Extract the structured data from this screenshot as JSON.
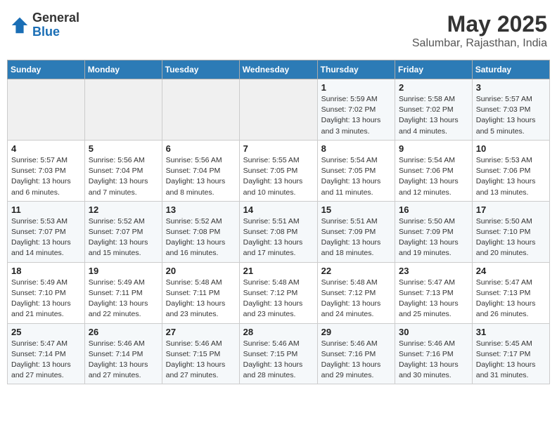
{
  "header": {
    "logo_general": "General",
    "logo_blue": "Blue",
    "month": "May 2025",
    "location": "Salumbar, Rajasthan, India"
  },
  "weekdays": [
    "Sunday",
    "Monday",
    "Tuesday",
    "Wednesday",
    "Thursday",
    "Friday",
    "Saturday"
  ],
  "weeks": [
    [
      {
        "day": "",
        "info": ""
      },
      {
        "day": "",
        "info": ""
      },
      {
        "day": "",
        "info": ""
      },
      {
        "day": "",
        "info": ""
      },
      {
        "day": "1",
        "info": "Sunrise: 5:59 AM\nSunset: 7:02 PM\nDaylight: 13 hours\nand 3 minutes."
      },
      {
        "day": "2",
        "info": "Sunrise: 5:58 AM\nSunset: 7:02 PM\nDaylight: 13 hours\nand 4 minutes."
      },
      {
        "day": "3",
        "info": "Sunrise: 5:57 AM\nSunset: 7:03 PM\nDaylight: 13 hours\nand 5 minutes."
      }
    ],
    [
      {
        "day": "4",
        "info": "Sunrise: 5:57 AM\nSunset: 7:03 PM\nDaylight: 13 hours\nand 6 minutes."
      },
      {
        "day": "5",
        "info": "Sunrise: 5:56 AM\nSunset: 7:04 PM\nDaylight: 13 hours\nand 7 minutes."
      },
      {
        "day": "6",
        "info": "Sunrise: 5:56 AM\nSunset: 7:04 PM\nDaylight: 13 hours\nand 8 minutes."
      },
      {
        "day": "7",
        "info": "Sunrise: 5:55 AM\nSunset: 7:05 PM\nDaylight: 13 hours\nand 10 minutes."
      },
      {
        "day": "8",
        "info": "Sunrise: 5:54 AM\nSunset: 7:05 PM\nDaylight: 13 hours\nand 11 minutes."
      },
      {
        "day": "9",
        "info": "Sunrise: 5:54 AM\nSunset: 7:06 PM\nDaylight: 13 hours\nand 12 minutes."
      },
      {
        "day": "10",
        "info": "Sunrise: 5:53 AM\nSunset: 7:06 PM\nDaylight: 13 hours\nand 13 minutes."
      }
    ],
    [
      {
        "day": "11",
        "info": "Sunrise: 5:53 AM\nSunset: 7:07 PM\nDaylight: 13 hours\nand 14 minutes."
      },
      {
        "day": "12",
        "info": "Sunrise: 5:52 AM\nSunset: 7:07 PM\nDaylight: 13 hours\nand 15 minutes."
      },
      {
        "day": "13",
        "info": "Sunrise: 5:52 AM\nSunset: 7:08 PM\nDaylight: 13 hours\nand 16 minutes."
      },
      {
        "day": "14",
        "info": "Sunrise: 5:51 AM\nSunset: 7:08 PM\nDaylight: 13 hours\nand 17 minutes."
      },
      {
        "day": "15",
        "info": "Sunrise: 5:51 AM\nSunset: 7:09 PM\nDaylight: 13 hours\nand 18 minutes."
      },
      {
        "day": "16",
        "info": "Sunrise: 5:50 AM\nSunset: 7:09 PM\nDaylight: 13 hours\nand 19 minutes."
      },
      {
        "day": "17",
        "info": "Sunrise: 5:50 AM\nSunset: 7:10 PM\nDaylight: 13 hours\nand 20 minutes."
      }
    ],
    [
      {
        "day": "18",
        "info": "Sunrise: 5:49 AM\nSunset: 7:10 PM\nDaylight: 13 hours\nand 21 minutes."
      },
      {
        "day": "19",
        "info": "Sunrise: 5:49 AM\nSunset: 7:11 PM\nDaylight: 13 hours\nand 22 minutes."
      },
      {
        "day": "20",
        "info": "Sunrise: 5:48 AM\nSunset: 7:11 PM\nDaylight: 13 hours\nand 23 minutes."
      },
      {
        "day": "21",
        "info": "Sunrise: 5:48 AM\nSunset: 7:12 PM\nDaylight: 13 hours\nand 23 minutes."
      },
      {
        "day": "22",
        "info": "Sunrise: 5:48 AM\nSunset: 7:12 PM\nDaylight: 13 hours\nand 24 minutes."
      },
      {
        "day": "23",
        "info": "Sunrise: 5:47 AM\nSunset: 7:13 PM\nDaylight: 13 hours\nand 25 minutes."
      },
      {
        "day": "24",
        "info": "Sunrise: 5:47 AM\nSunset: 7:13 PM\nDaylight: 13 hours\nand 26 minutes."
      }
    ],
    [
      {
        "day": "25",
        "info": "Sunrise: 5:47 AM\nSunset: 7:14 PM\nDaylight: 13 hours\nand 27 minutes."
      },
      {
        "day": "26",
        "info": "Sunrise: 5:46 AM\nSunset: 7:14 PM\nDaylight: 13 hours\nand 27 minutes."
      },
      {
        "day": "27",
        "info": "Sunrise: 5:46 AM\nSunset: 7:15 PM\nDaylight: 13 hours\nand 27 minutes."
      },
      {
        "day": "28",
        "info": "Sunrise: 5:46 AM\nSunset: 7:15 PM\nDaylight: 13 hours\nand 28 minutes."
      },
      {
        "day": "29",
        "info": "Sunrise: 5:46 AM\nSunset: 7:16 PM\nDaylight: 13 hours\nand 29 minutes."
      },
      {
        "day": "30",
        "info": "Sunrise: 5:46 AM\nSunset: 7:16 PM\nDaylight: 13 hours\nand 30 minutes."
      },
      {
        "day": "31",
        "info": "Sunrise: 5:45 AM\nSunset: 7:17 PM\nDaylight: 13 hours\nand 31 minutes."
      }
    ]
  ]
}
